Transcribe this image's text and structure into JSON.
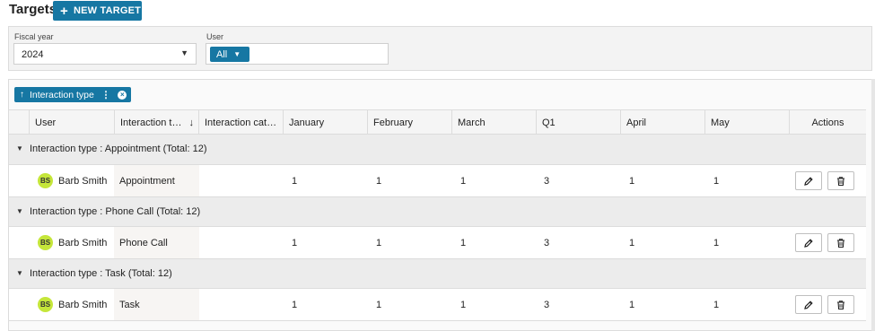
{
  "page": {
    "title": "Targets",
    "new_target_label": "NEW TARGET"
  },
  "filters": {
    "fiscal_year_label": "Fiscal year",
    "fiscal_year_value": "2024",
    "user_label": "User",
    "user_chip": "All"
  },
  "grouping": {
    "chip_label": "Interaction type"
  },
  "columns": [
    "User",
    "Interaction t…",
    "Interaction cat…",
    "January",
    "February",
    "March",
    "Q1",
    "April",
    "May",
    "Actions"
  ],
  "groups": [
    {
      "title": "Interaction type : Appointment (Total: 12)",
      "row": {
        "initials": "BS",
        "user": "Barb Smith",
        "interaction_type": "Appointment",
        "category": "",
        "january": "1",
        "february": "1",
        "march": "1",
        "q1": "3",
        "april": "1",
        "may": "1"
      }
    },
    {
      "title": "Interaction type : Phone Call (Total: 12)",
      "row": {
        "initials": "BS",
        "user": "Barb Smith",
        "interaction_type": "Phone Call",
        "category": "",
        "january": "1",
        "february": "1",
        "march": "1",
        "q1": "3",
        "april": "1",
        "may": "1"
      }
    },
    {
      "title": "Interaction type : Task (Total: 12)",
      "row": {
        "initials": "BS",
        "user": "Barb Smith",
        "interaction_type": "Task",
        "category": "",
        "january": "1",
        "february": "1",
        "march": "1",
        "q1": "3",
        "april": "1",
        "may": "1"
      }
    }
  ],
  "icons": {
    "add": "plus-icon",
    "edit": "pencil-icon",
    "delete": "trash-icon",
    "caret": "caret-down-icon",
    "sort": "arrow-down-icon",
    "group_sort": "arrow-up-icon",
    "more": "kebab-icon",
    "remove": "close-circle-icon"
  },
  "colors": {
    "accent": "#1677a3",
    "avatar": "#c5e63a",
    "group_row": "#ececec"
  }
}
